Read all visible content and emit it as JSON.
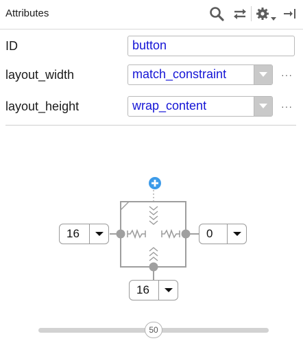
{
  "header": {
    "title": "Attributes",
    "icons": [
      "search-icon",
      "swap-arrows-icon",
      "gear-icon",
      "chevron-down-icon",
      "pin-to-right-icon"
    ]
  },
  "attributes": [
    {
      "label": "ID",
      "value": "button",
      "type": "text"
    },
    {
      "label": "layout_width",
      "value": "match_constraint",
      "type": "combo"
    },
    {
      "label": "layout_height",
      "value": "wrap_content",
      "type": "combo"
    }
  ],
  "more_label": "···",
  "constraints": {
    "left_margin": "16",
    "right_margin": "0",
    "bottom_margin": "16",
    "add_top_constraint_icon": "plus-circle-icon"
  },
  "bias_slider": {
    "value": "50",
    "level": 0.5
  },
  "colors": {
    "value_text": "#1414d6",
    "add_icon": "#3d9be9",
    "widget_stroke": "#9e9e9e",
    "anchor_dot": "#a0a0a0"
  }
}
